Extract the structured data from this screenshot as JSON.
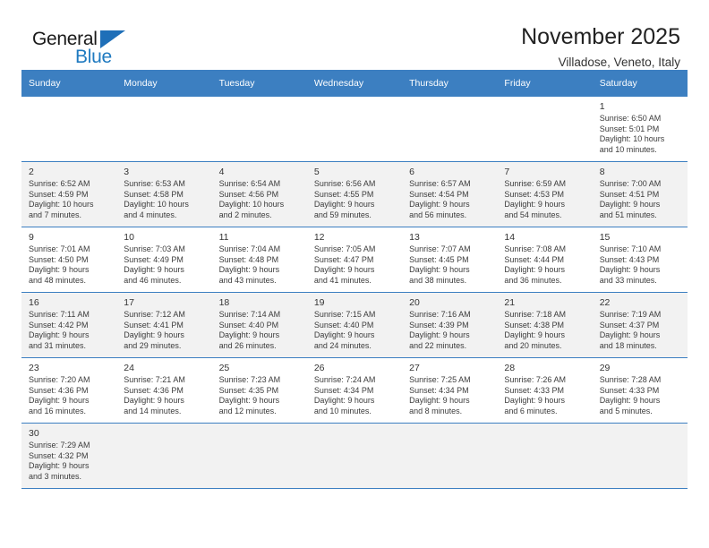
{
  "brand": {
    "name_part1": "General",
    "name_part2": "Blue",
    "accent_color": "#1f7ac0",
    "header_color": "#3c7fc1"
  },
  "header": {
    "title": "November 2025",
    "location": "Villadose, Veneto, Italy"
  },
  "calendar": {
    "weekday_headers": [
      "Sunday",
      "Monday",
      "Tuesday",
      "Wednesday",
      "Thursday",
      "Friday",
      "Saturday"
    ],
    "weeks": [
      {
        "shaded": false,
        "days": [
          {
            "num": "",
            "info": ""
          },
          {
            "num": "",
            "info": ""
          },
          {
            "num": "",
            "info": ""
          },
          {
            "num": "",
            "info": ""
          },
          {
            "num": "",
            "info": ""
          },
          {
            "num": "",
            "info": ""
          },
          {
            "num": "1",
            "info": "Sunrise: 6:50 AM\nSunset: 5:01 PM\nDaylight: 10 hours\nand 10 minutes."
          }
        ]
      },
      {
        "shaded": true,
        "days": [
          {
            "num": "2",
            "info": "Sunrise: 6:52 AM\nSunset: 4:59 PM\nDaylight: 10 hours\nand 7 minutes."
          },
          {
            "num": "3",
            "info": "Sunrise: 6:53 AM\nSunset: 4:58 PM\nDaylight: 10 hours\nand 4 minutes."
          },
          {
            "num": "4",
            "info": "Sunrise: 6:54 AM\nSunset: 4:56 PM\nDaylight: 10 hours\nand 2 minutes."
          },
          {
            "num": "5",
            "info": "Sunrise: 6:56 AM\nSunset: 4:55 PM\nDaylight: 9 hours\nand 59 minutes."
          },
          {
            "num": "6",
            "info": "Sunrise: 6:57 AM\nSunset: 4:54 PM\nDaylight: 9 hours\nand 56 minutes."
          },
          {
            "num": "7",
            "info": "Sunrise: 6:59 AM\nSunset: 4:53 PM\nDaylight: 9 hours\nand 54 minutes."
          },
          {
            "num": "8",
            "info": "Sunrise: 7:00 AM\nSunset: 4:51 PM\nDaylight: 9 hours\nand 51 minutes."
          }
        ]
      },
      {
        "shaded": false,
        "days": [
          {
            "num": "9",
            "info": "Sunrise: 7:01 AM\nSunset: 4:50 PM\nDaylight: 9 hours\nand 48 minutes."
          },
          {
            "num": "10",
            "info": "Sunrise: 7:03 AM\nSunset: 4:49 PM\nDaylight: 9 hours\nand 46 minutes."
          },
          {
            "num": "11",
            "info": "Sunrise: 7:04 AM\nSunset: 4:48 PM\nDaylight: 9 hours\nand 43 minutes."
          },
          {
            "num": "12",
            "info": "Sunrise: 7:05 AM\nSunset: 4:47 PM\nDaylight: 9 hours\nand 41 minutes."
          },
          {
            "num": "13",
            "info": "Sunrise: 7:07 AM\nSunset: 4:45 PM\nDaylight: 9 hours\nand 38 minutes."
          },
          {
            "num": "14",
            "info": "Sunrise: 7:08 AM\nSunset: 4:44 PM\nDaylight: 9 hours\nand 36 minutes."
          },
          {
            "num": "15",
            "info": "Sunrise: 7:10 AM\nSunset: 4:43 PM\nDaylight: 9 hours\nand 33 minutes."
          }
        ]
      },
      {
        "shaded": true,
        "days": [
          {
            "num": "16",
            "info": "Sunrise: 7:11 AM\nSunset: 4:42 PM\nDaylight: 9 hours\nand 31 minutes."
          },
          {
            "num": "17",
            "info": "Sunrise: 7:12 AM\nSunset: 4:41 PM\nDaylight: 9 hours\nand 29 minutes."
          },
          {
            "num": "18",
            "info": "Sunrise: 7:14 AM\nSunset: 4:40 PM\nDaylight: 9 hours\nand 26 minutes."
          },
          {
            "num": "19",
            "info": "Sunrise: 7:15 AM\nSunset: 4:40 PM\nDaylight: 9 hours\nand 24 minutes."
          },
          {
            "num": "20",
            "info": "Sunrise: 7:16 AM\nSunset: 4:39 PM\nDaylight: 9 hours\nand 22 minutes."
          },
          {
            "num": "21",
            "info": "Sunrise: 7:18 AM\nSunset: 4:38 PM\nDaylight: 9 hours\nand 20 minutes."
          },
          {
            "num": "22",
            "info": "Sunrise: 7:19 AM\nSunset: 4:37 PM\nDaylight: 9 hours\nand 18 minutes."
          }
        ]
      },
      {
        "shaded": false,
        "days": [
          {
            "num": "23",
            "info": "Sunrise: 7:20 AM\nSunset: 4:36 PM\nDaylight: 9 hours\nand 16 minutes."
          },
          {
            "num": "24",
            "info": "Sunrise: 7:21 AM\nSunset: 4:36 PM\nDaylight: 9 hours\nand 14 minutes."
          },
          {
            "num": "25",
            "info": "Sunrise: 7:23 AM\nSunset: 4:35 PM\nDaylight: 9 hours\nand 12 minutes."
          },
          {
            "num": "26",
            "info": "Sunrise: 7:24 AM\nSunset: 4:34 PM\nDaylight: 9 hours\nand 10 minutes."
          },
          {
            "num": "27",
            "info": "Sunrise: 7:25 AM\nSunset: 4:34 PM\nDaylight: 9 hours\nand 8 minutes."
          },
          {
            "num": "28",
            "info": "Sunrise: 7:26 AM\nSunset: 4:33 PM\nDaylight: 9 hours\nand 6 minutes."
          },
          {
            "num": "29",
            "info": "Sunrise: 7:28 AM\nSunset: 4:33 PM\nDaylight: 9 hours\nand 5 minutes."
          }
        ]
      },
      {
        "shaded": true,
        "days": [
          {
            "num": "30",
            "info": "Sunrise: 7:29 AM\nSunset: 4:32 PM\nDaylight: 9 hours\nand 3 minutes."
          },
          {
            "num": "",
            "info": ""
          },
          {
            "num": "",
            "info": ""
          },
          {
            "num": "",
            "info": ""
          },
          {
            "num": "",
            "info": ""
          },
          {
            "num": "",
            "info": ""
          },
          {
            "num": "",
            "info": ""
          }
        ]
      }
    ]
  }
}
